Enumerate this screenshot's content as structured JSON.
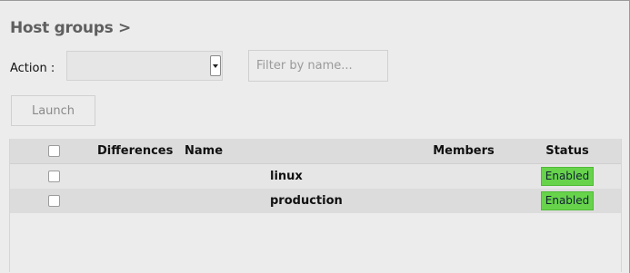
{
  "header": {
    "title": "Host groups >"
  },
  "toolbar": {
    "action_label": "Action :",
    "action_selected": "",
    "filter_placeholder": "Filter by name...",
    "launch_label": "Launch"
  },
  "table": {
    "headers": {
      "differences": "Differences",
      "name": "Name",
      "members": "Members",
      "status": "Status"
    },
    "rows": [
      {
        "checked": false,
        "differences": "",
        "name": "linux",
        "members": "",
        "status": "Enabled"
      },
      {
        "checked": false,
        "differences": "",
        "name": "production",
        "members": "",
        "status": "Enabled"
      }
    ]
  },
  "colors": {
    "status_enabled": "#67d34b",
    "page_background": "#ececec"
  },
  "icons": {
    "select_arrow": "chevron-down-icon",
    "checkbox": "checkbox-icon"
  }
}
